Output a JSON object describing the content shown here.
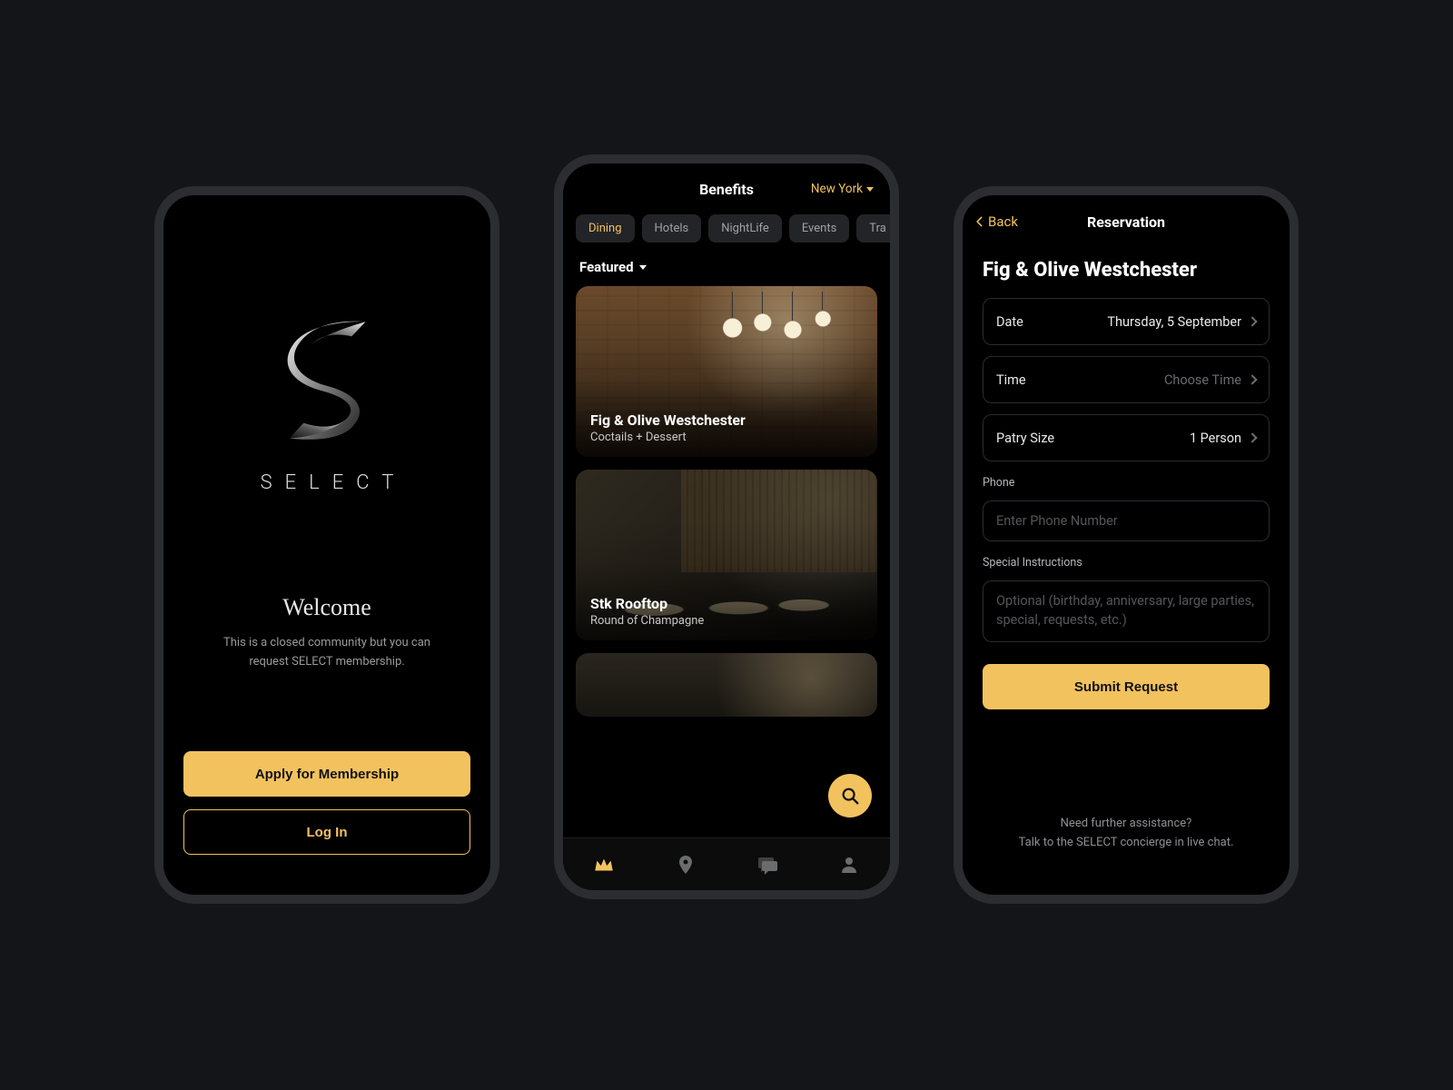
{
  "colors": {
    "accent": "#f2c25e",
    "bg": "#141518",
    "panel": "#000"
  },
  "welcome": {
    "brand": "SELECT",
    "title": "Welcome",
    "subtitle": "This is a closed community but you can request SELECT membership.",
    "apply_label": "Apply for Membership",
    "login_label": "Log In"
  },
  "benefits": {
    "title": "Benefits",
    "city": "New York",
    "categories": [
      "Dining",
      "Hotels",
      "NightLife",
      "Events",
      "Tra"
    ],
    "active_category_index": 0,
    "sort_label": "Featured",
    "cards": [
      {
        "title": "Fig & Olive Westchester",
        "subtitle": "Coctails + Dessert"
      },
      {
        "title": "Stk Rooftop",
        "subtitle": "Round of Champagne"
      }
    ],
    "fab_icon": "search-icon",
    "tabs": [
      "crown-icon",
      "pin-icon",
      "chat-icon",
      "person-icon"
    ],
    "active_tab_index": 0
  },
  "reservation": {
    "back_label": "Back",
    "title": "Reservation",
    "venue": "Fig & Olive Westchester",
    "rows": {
      "date": {
        "label": "Date",
        "value": "Thursday, 5 September"
      },
      "time": {
        "label": "Time",
        "placeholder": "Choose Time"
      },
      "party": {
        "label": "Patry Size",
        "value": "1 Person"
      }
    },
    "phone": {
      "label": "Phone",
      "placeholder": "Enter Phone Number"
    },
    "instructions": {
      "label": "Special Instructions",
      "placeholder": "Optional (birthday, anniversary, large parties, special, requests, etc.)"
    },
    "submit_label": "Submit Request",
    "assist_line1": "Need further assistance?",
    "assist_line2": "Talk to the SELECT concierge in live chat."
  }
}
